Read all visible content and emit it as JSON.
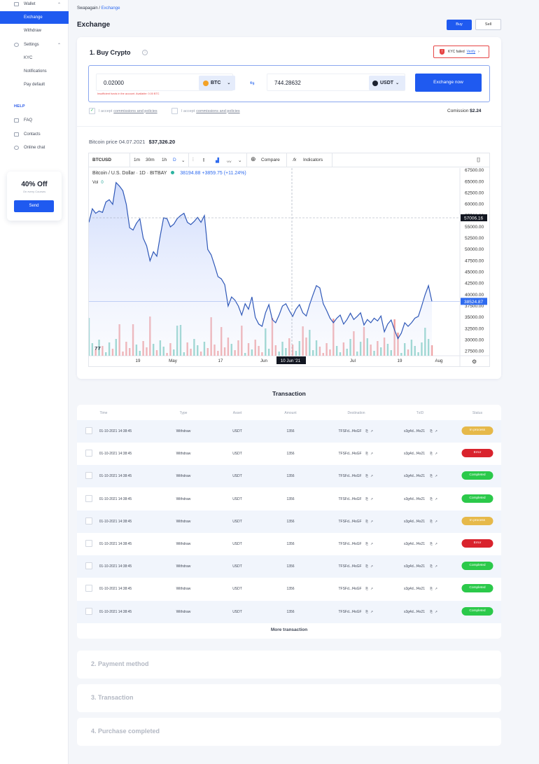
{
  "sidebar": {
    "wallet": "Wallet",
    "exchange": "Exchange",
    "withdraw": "Withdraw",
    "settings": "Settings",
    "kyc": "KYC",
    "notifications": "Notifications",
    "pay_default": "Pay default",
    "help_heading": "HELP",
    "faq": "FAQ",
    "contacts": "Contacts",
    "online_chat": "Online chat",
    "promo": {
      "title": "40% Off",
      "subtitle": "On every Courses",
      "button": "Send"
    }
  },
  "breadcrumb": {
    "root": "Swapagain",
    "sep": "/",
    "current": "Exchange"
  },
  "page_title": "Exchange",
  "header_buttons": {
    "buy": "Buy",
    "sell": "Sell"
  },
  "buy_crypto": {
    "title": "1. Buy Crypto",
    "info_icon": "i",
    "kyc_status": "KYC failed",
    "kyc_link": "Verify",
    "kyc_chevron": "›",
    "from_amount": "0.02000",
    "from_currency": "BTC",
    "to_amount": "744.28632",
    "to_currency": "USDT",
    "error": "Insufficient funds in the account. Available: 0.00 BTC",
    "swap_icon": "⇆",
    "exchange_button": "Exchange now",
    "accept_1": {
      "pre": "I accept",
      "link": "commissions and policies",
      "checked": true
    },
    "accept_2": {
      "pre": "I accept",
      "link": "commissions and policies",
      "checked": false
    },
    "commission_label": "Comission",
    "commission_value": "$2.24",
    "price_label": "Bitcoin price 04.07.2021",
    "price_value": "$37,326.20"
  },
  "chart_toolbar": {
    "symbol": "BTCUSD",
    "intervals": [
      "1m",
      "30m",
      "1h",
      "D"
    ],
    "compare": "Compare",
    "indicators": "Indicators"
  },
  "chart_legend": {
    "name": "Bitcoin / U.S. Dollar · 1D · BITBAY",
    "values": "38194.88  +3859.75 (+11.24%)",
    "vol_label": "Vol",
    "vol_value": "0"
  },
  "chart_data": {
    "type": "line",
    "title": "Bitcoin / U.S. Dollar · 1D · BITBAY",
    "y_ticks": [
      67500,
      65000,
      62500,
      60000,
      57500,
      55000,
      52500,
      50000,
      47500,
      45000,
      42500,
      40000,
      37500,
      35000,
      32500,
      30000,
      27500
    ],
    "y_tick_labels": [
      "67500.00",
      "65000.00",
      "62500.00",
      "60000.00",
      "57500.00",
      "55000.00",
      "52500.00",
      "50000.00",
      "47500.00",
      "45000.00",
      "42500.00",
      "40000.00",
      "37500.00",
      "35000.00",
      "32500.00",
      "30000.00",
      "27500.00"
    ],
    "ylim": [
      26500,
      68000
    ],
    "x_tick_labels": [
      "19",
      "May",
      "17",
      "Jun",
      "10 Jun '21",
      "Jul",
      "19",
      "Aug"
    ],
    "crosshair_price": "57006.16",
    "last_price": "38524.87",
    "series": [
      {
        "values": [
          56000,
          59000,
          58000,
          58500,
          58200,
          60500,
          61000,
          60000,
          64800,
          64000,
          63000,
          60000,
          54800,
          54300,
          55800,
          56800,
          52500,
          50800,
          47500,
          49500,
          48500,
          53000,
          57000,
          56800,
          55000,
          55600,
          56800,
          57500,
          58000,
          56000,
          55500,
          56200,
          57100,
          56000,
          57500,
          50000,
          48800,
          46500,
          44000,
          43500,
          42200,
          37500,
          39500,
          38800,
          37500,
          35500,
          38000,
          36800,
          39500,
          35000,
          33500,
          33000,
          36000,
          37800,
          34500,
          33800,
          35500,
          37500,
          38000,
          36500,
          35200,
          36800,
          37800,
          36000,
          35300,
          37800,
          40000,
          42000,
          41500,
          38000,
          36500,
          34800,
          33800,
          34800,
          35500,
          33500,
          34500,
          35900,
          34500,
          35200,
          36000,
          33300,
          34500,
          33800,
          34800,
          34200,
          35300,
          31800,
          33500,
          34400,
          32200,
          30300,
          31500,
          33800,
          33000,
          33800,
          34800,
          35200,
          37500,
          40000,
          42000,
          38500
        ]
      }
    ],
    "volumes_up": [
      0,
      0,
      0,
      0,
      0,
      0,
      0,
      0,
      0,
      0,
      0,
      0,
      0,
      0,
      0,
      0,
      0,
      0,
      0,
      0
    ],
    "grid": true
  },
  "transactions": {
    "title": "Transaction",
    "columns": [
      "Time",
      "Type",
      "Asset",
      "Amount",
      "Destination",
      "TxID",
      "Status"
    ],
    "rows": [
      {
        "time": "01-10-2021 14:38:45",
        "type": "Withdraw",
        "asset": "USDT",
        "amount": "1356",
        "dest": "TFSFd...f4sGF",
        "txid": "s3g4d...f4s21",
        "status": "In process"
      },
      {
        "time": "01-10-2021 14:38:45",
        "type": "Withdraw",
        "asset": "USDT",
        "amount": "1356",
        "dest": "TFSFd...f4sGF",
        "txid": "s3g4d...f4s21",
        "status": "Error"
      },
      {
        "time": "01-10-2021 14:38:45",
        "type": "Withdraw",
        "asset": "USDT",
        "amount": "1356",
        "dest": "TFSFd...f4sGF",
        "txid": "s3g4d...f4s21",
        "status": "Completed"
      },
      {
        "time": "01-10-2021 14:38:45",
        "type": "Withdraw",
        "asset": "USDT",
        "amount": "1356",
        "dest": "TFSFd...f4sGF",
        "txid": "s3g4d...f4s21",
        "status": "Completed"
      },
      {
        "time": "01-10-2021 14:38:45",
        "type": "Withdraw",
        "asset": "USDT",
        "amount": "1356",
        "dest": "TFSFd...f4sGF",
        "txid": "s3g4d...f4s21",
        "status": "In process"
      },
      {
        "time": "01-10-2021 14:38:45",
        "type": "Withdraw",
        "asset": "USDT",
        "amount": "1356",
        "dest": "TFSFd...f4sGF",
        "txid": "s3g4d...f4s21",
        "status": "Error"
      },
      {
        "time": "01-10-2021 14:38:45",
        "type": "Withdraw",
        "asset": "USDT",
        "amount": "1356",
        "dest": "TFSFd...f4sGF",
        "txid": "s3g4d...f4s21",
        "status": "Completed"
      },
      {
        "time": "01-10-2021 14:38:45",
        "type": "Withdraw",
        "asset": "USDT",
        "amount": "1356",
        "dest": "TFSFd...f4sGF",
        "txid": "s3g4d...f4s21",
        "status": "Completed"
      },
      {
        "time": "01-10-2021 14:38:45",
        "type": "Withdraw",
        "asset": "USDT",
        "amount": "1356",
        "dest": "TFSFd...f4sGF",
        "txid": "s3g4d...f4s21",
        "status": "Completed"
      }
    ],
    "more": "More transaction"
  },
  "steps": {
    "payment": "2. Payment method",
    "transaction": "3. Transaction",
    "completed": "4. Purchase completed"
  },
  "colors": {
    "accent": "#1f5af0",
    "in_process": "#e6b94a",
    "error": "#d9232d",
    "completed": "#2bc94a",
    "line": "#2f58b8",
    "vol_up": "#7ccbbf",
    "vol_down": "#ef9a9a"
  }
}
